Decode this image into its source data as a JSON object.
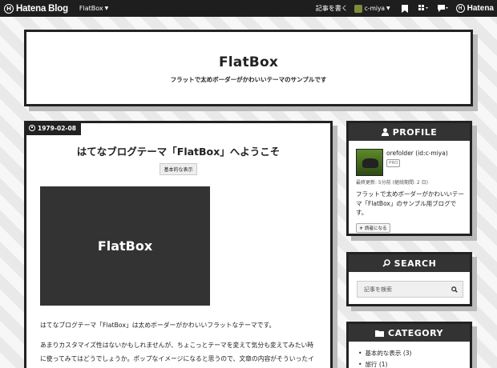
{
  "topbar": {
    "logo_text": "Hatena Blog",
    "blog_selector": "FlatBox",
    "write_link": "記事を書く",
    "user": "c-miya",
    "hatena_text": "Hatena"
  },
  "header": {
    "title": "FlatBox",
    "description": "フラットで太めボーダーがかわいいテーマのサンプルです"
  },
  "article": {
    "date": "1979-02-08",
    "title": "はてなブログテーマ「FlatBox」へようこそ",
    "category": "基本的な表示",
    "thumbnail_text": "FlatBox",
    "paragraph1": "はてなブログテーマ「FlatBox」は太めボーダーがかわいいフラットなテーマです。",
    "paragraph2": "あまりカスタマイズ性はないかもしれませんが、ちょこっとテーマを変えて気分も変えてみたい時に使ってみてはどうでしょうか。ポップなイメージになると思うので、文章の内容がそういったイメージのブログに似合うと思います。"
  },
  "profile": {
    "heading": "PROFILE",
    "name": "orefolder (id:c-miya)",
    "badge": "PRO",
    "meta": "最終更新: 5分前 (継続期間: 2 日)",
    "description": "フラットで太めボーダーがかわいいテーマ「FlatBox」のサンプル用ブログです。",
    "reader_button": "読者になる"
  },
  "search": {
    "heading": "SEARCH",
    "placeholder": "記事を検索"
  },
  "category": {
    "heading": "CATEGORY",
    "items": [
      "基本的な表示 (3)",
      "旅行 (1)"
    ]
  },
  "colors": {
    "dark": "#222222",
    "header_bar": "#333333",
    "shadow": "#bbbbbb"
  }
}
